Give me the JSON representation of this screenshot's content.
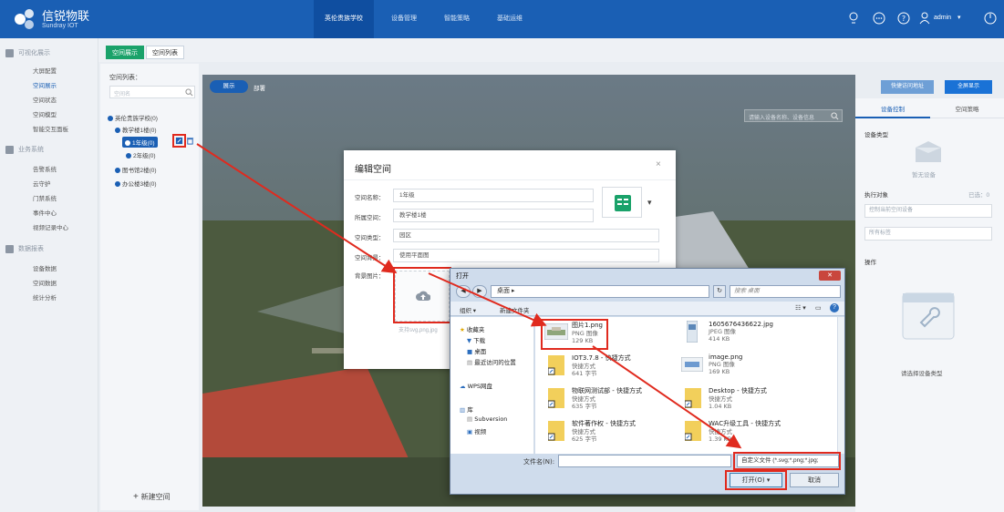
{
  "app": {
    "title": "信锐物联",
    "subtitle": "Sundray IOT"
  },
  "topnav": [
    "英伦贵族学校",
    "设备管理",
    "智能策略",
    "基础运维"
  ],
  "user": {
    "name": "admin"
  },
  "sidebar": {
    "groups": [
      {
        "label": "可视化展示",
        "items": [
          "大屏配置",
          "空间展示",
          "空间状态",
          "空间模型",
          "智能交互面板"
        ]
      },
      {
        "label": "业务系统",
        "items": [
          "告警系统",
          "云守护",
          "门禁系统",
          "事件中心",
          "视频记录中心"
        ]
      },
      {
        "label": "数据报表",
        "items": [
          "设备数据",
          "空间数据",
          "统计分析"
        ]
      }
    ],
    "active": "空间展示"
  },
  "tabs": [
    "空间展示",
    "空间列表"
  ],
  "tree": {
    "title": "空间列表：",
    "search_placeholder": "空间名",
    "nodes": [
      "英伦贵族学校(0)",
      "教学楼1楼(0)",
      "1年级(0)",
      "2年级(0)",
      "图书馆2楼(0)",
      "办公楼3楼(0)"
    ],
    "add_label": "新建空间"
  },
  "toolbar": {
    "display": "展示",
    "layout": "部署",
    "quick_access": "快捷访问地址",
    "fullscreen": "全屏显示"
  },
  "scene": {
    "search_placeholder": "请输入设备名称、设备信息"
  },
  "right_panel": {
    "tabs": [
      "设备控制",
      "空间策略"
    ],
    "device_type_label": "设备类型",
    "no_device": "暂无设备",
    "exec_object": "执行对象",
    "selected": "已选：0",
    "select_device_placeholder": "控制当前空间设备",
    "all_tags": "所有标签",
    "operation": "操作",
    "choose_device_type": "请选择设备类型"
  },
  "edit_dialog": {
    "title": "编辑空间",
    "fields": [
      {
        "label": "空间名称：",
        "value": "1年级"
      },
      {
        "label": "所属空间：",
        "value": "教学楼1楼"
      },
      {
        "label": "空间类型：",
        "value": "园区"
      },
      {
        "label": "空间背景：",
        "value": "使用平面图"
      }
    ],
    "bg_label": "背景图片：",
    "upload_hint": "支持svg,png,jpg"
  },
  "file_dialog": {
    "title": "打开",
    "path": "桌面",
    "search_placeholder": "搜索 桌面",
    "organize": "组织 ▾",
    "new_folder": "新建文件夹",
    "nav": [
      "收藏夹",
      "下载",
      "桌面",
      "最近访问的位置",
      "WPS网盘",
      "库",
      "Subversion",
      "视频"
    ],
    "files": [
      {
        "name": "图片1.png",
        "type": "PNG 图像",
        "size": "129 KB"
      },
      {
        "name": "1605676436622.jpg",
        "type": "JPEG 图像",
        "size": "414 KB"
      },
      {
        "name": "IOT3.7.8 - 快捷方式",
        "type": "快捷方式",
        "size": "641 字节"
      },
      {
        "name": "image.png",
        "type": "PNG 图像",
        "size": "169 KB"
      },
      {
        "name": "物联网测试部 - 快捷方式",
        "type": "快捷方式",
        "size": "635 字节"
      },
      {
        "name": "Desktop - 快捷方式",
        "type": "快捷方式",
        "size": "1.04 KB"
      },
      {
        "name": "软件著作权 - 快捷方式",
        "type": "快捷方式",
        "size": "625 字节"
      },
      {
        "name": "WAC升级工具 - 快捷方式",
        "type": "快捷方式",
        "size": "1.39 KB"
      }
    ],
    "filename_label": "文件名(N):",
    "filter": "自定义文件 (*.svg;*.png;*.jpg;",
    "open": "打开(O)",
    "cancel": "取消"
  },
  "colors": {
    "brand": "#1a5fb4",
    "accent": "#1aa26a",
    "annotation": "#e02a1e"
  }
}
